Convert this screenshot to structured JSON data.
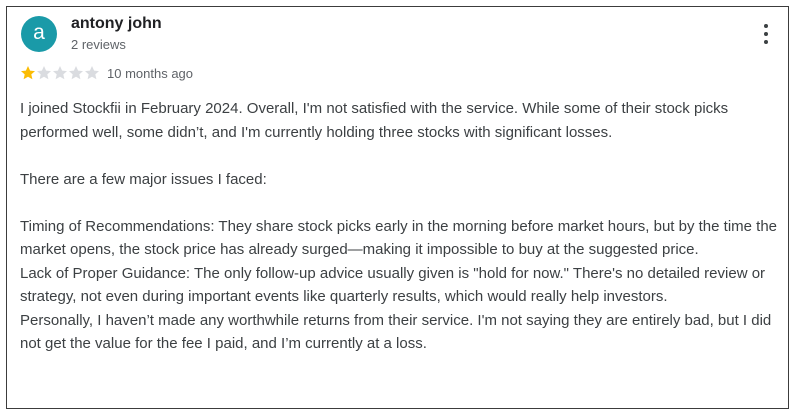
{
  "review": {
    "author_initial": "a",
    "author_name": "antony john",
    "author_reviews": "2 reviews",
    "rating": 1,
    "max_rating": 5,
    "star_filled_color": "#fbbc04",
    "star_empty_color": "#dadce0",
    "avatar_color": "#1a9aa8",
    "time_ago": "10 months ago",
    "more_icon": "more-vert-icon",
    "paragraphs": [
      "I joined Stockfii in February 2024. Overall, I'm not satisfied with the service. While some of their stock picks performed well, some didn’t, and I'm currently holding three stocks with significant losses.",
      "There are a few major issues I faced:",
      "Timing of Recommendations: They share stock picks early in the morning before market hours, but by the time the market opens, the stock price has already surged—making it impossible to buy at the suggested price.",
      "Lack of Proper Guidance: The only follow-up advice usually given is \"hold for now.\" There's no detailed review or strategy, not even during important events like quarterly results, which would really help investors.",
      "Personally, I haven’t made any worthwhile returns from their service. I'm not saying they are entirely bad, but I did not get the value for the fee I paid, and I’m currently at a loss."
    ]
  }
}
